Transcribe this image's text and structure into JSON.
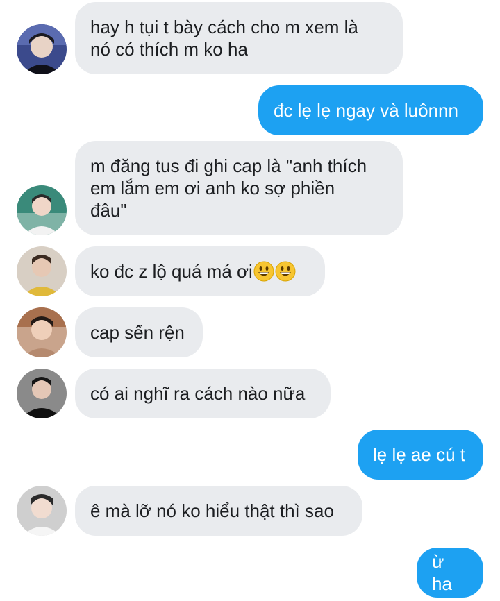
{
  "messages": [
    {
      "side": "in",
      "text": "hay h tụi t bày cách cho m xem là\nnó có thích m ko ha",
      "avatar": "avatar-dark-hair"
    },
    {
      "side": "out",
      "text": "đc lẹ lẹ ngay và luônnn"
    },
    {
      "side": "in",
      "text": "m đăng tus đi ghi cap là \"anh thích\nem lắm em ơi anh ko sợ phiền\nđâu\"",
      "avatar": "avatar-green-bg"
    },
    {
      "side": "in",
      "text": "ko đc z lộ quá má ơi",
      "avatar": "avatar-yellow-shirt",
      "emoji": [
        "grinning-face",
        "grinning-face"
      ]
    },
    {
      "side": "in",
      "text": "cap sến rện",
      "avatar": "avatar-warm-tone"
    },
    {
      "side": "in",
      "text": "có ai nghĩ ra cách nào nữa",
      "avatar": "avatar-dark-shirt"
    },
    {
      "side": "out",
      "text": "lẹ lẹ ae cú t"
    },
    {
      "side": "in",
      "text": "ê mà lỡ nó ko hiểu thật thì sao",
      "avatar": "avatar-light-bg"
    },
    {
      "side": "out",
      "text": "ừ ha"
    }
  ],
  "colors": {
    "incoming": "#e9ebee",
    "outgoing": "#1da1f2"
  }
}
